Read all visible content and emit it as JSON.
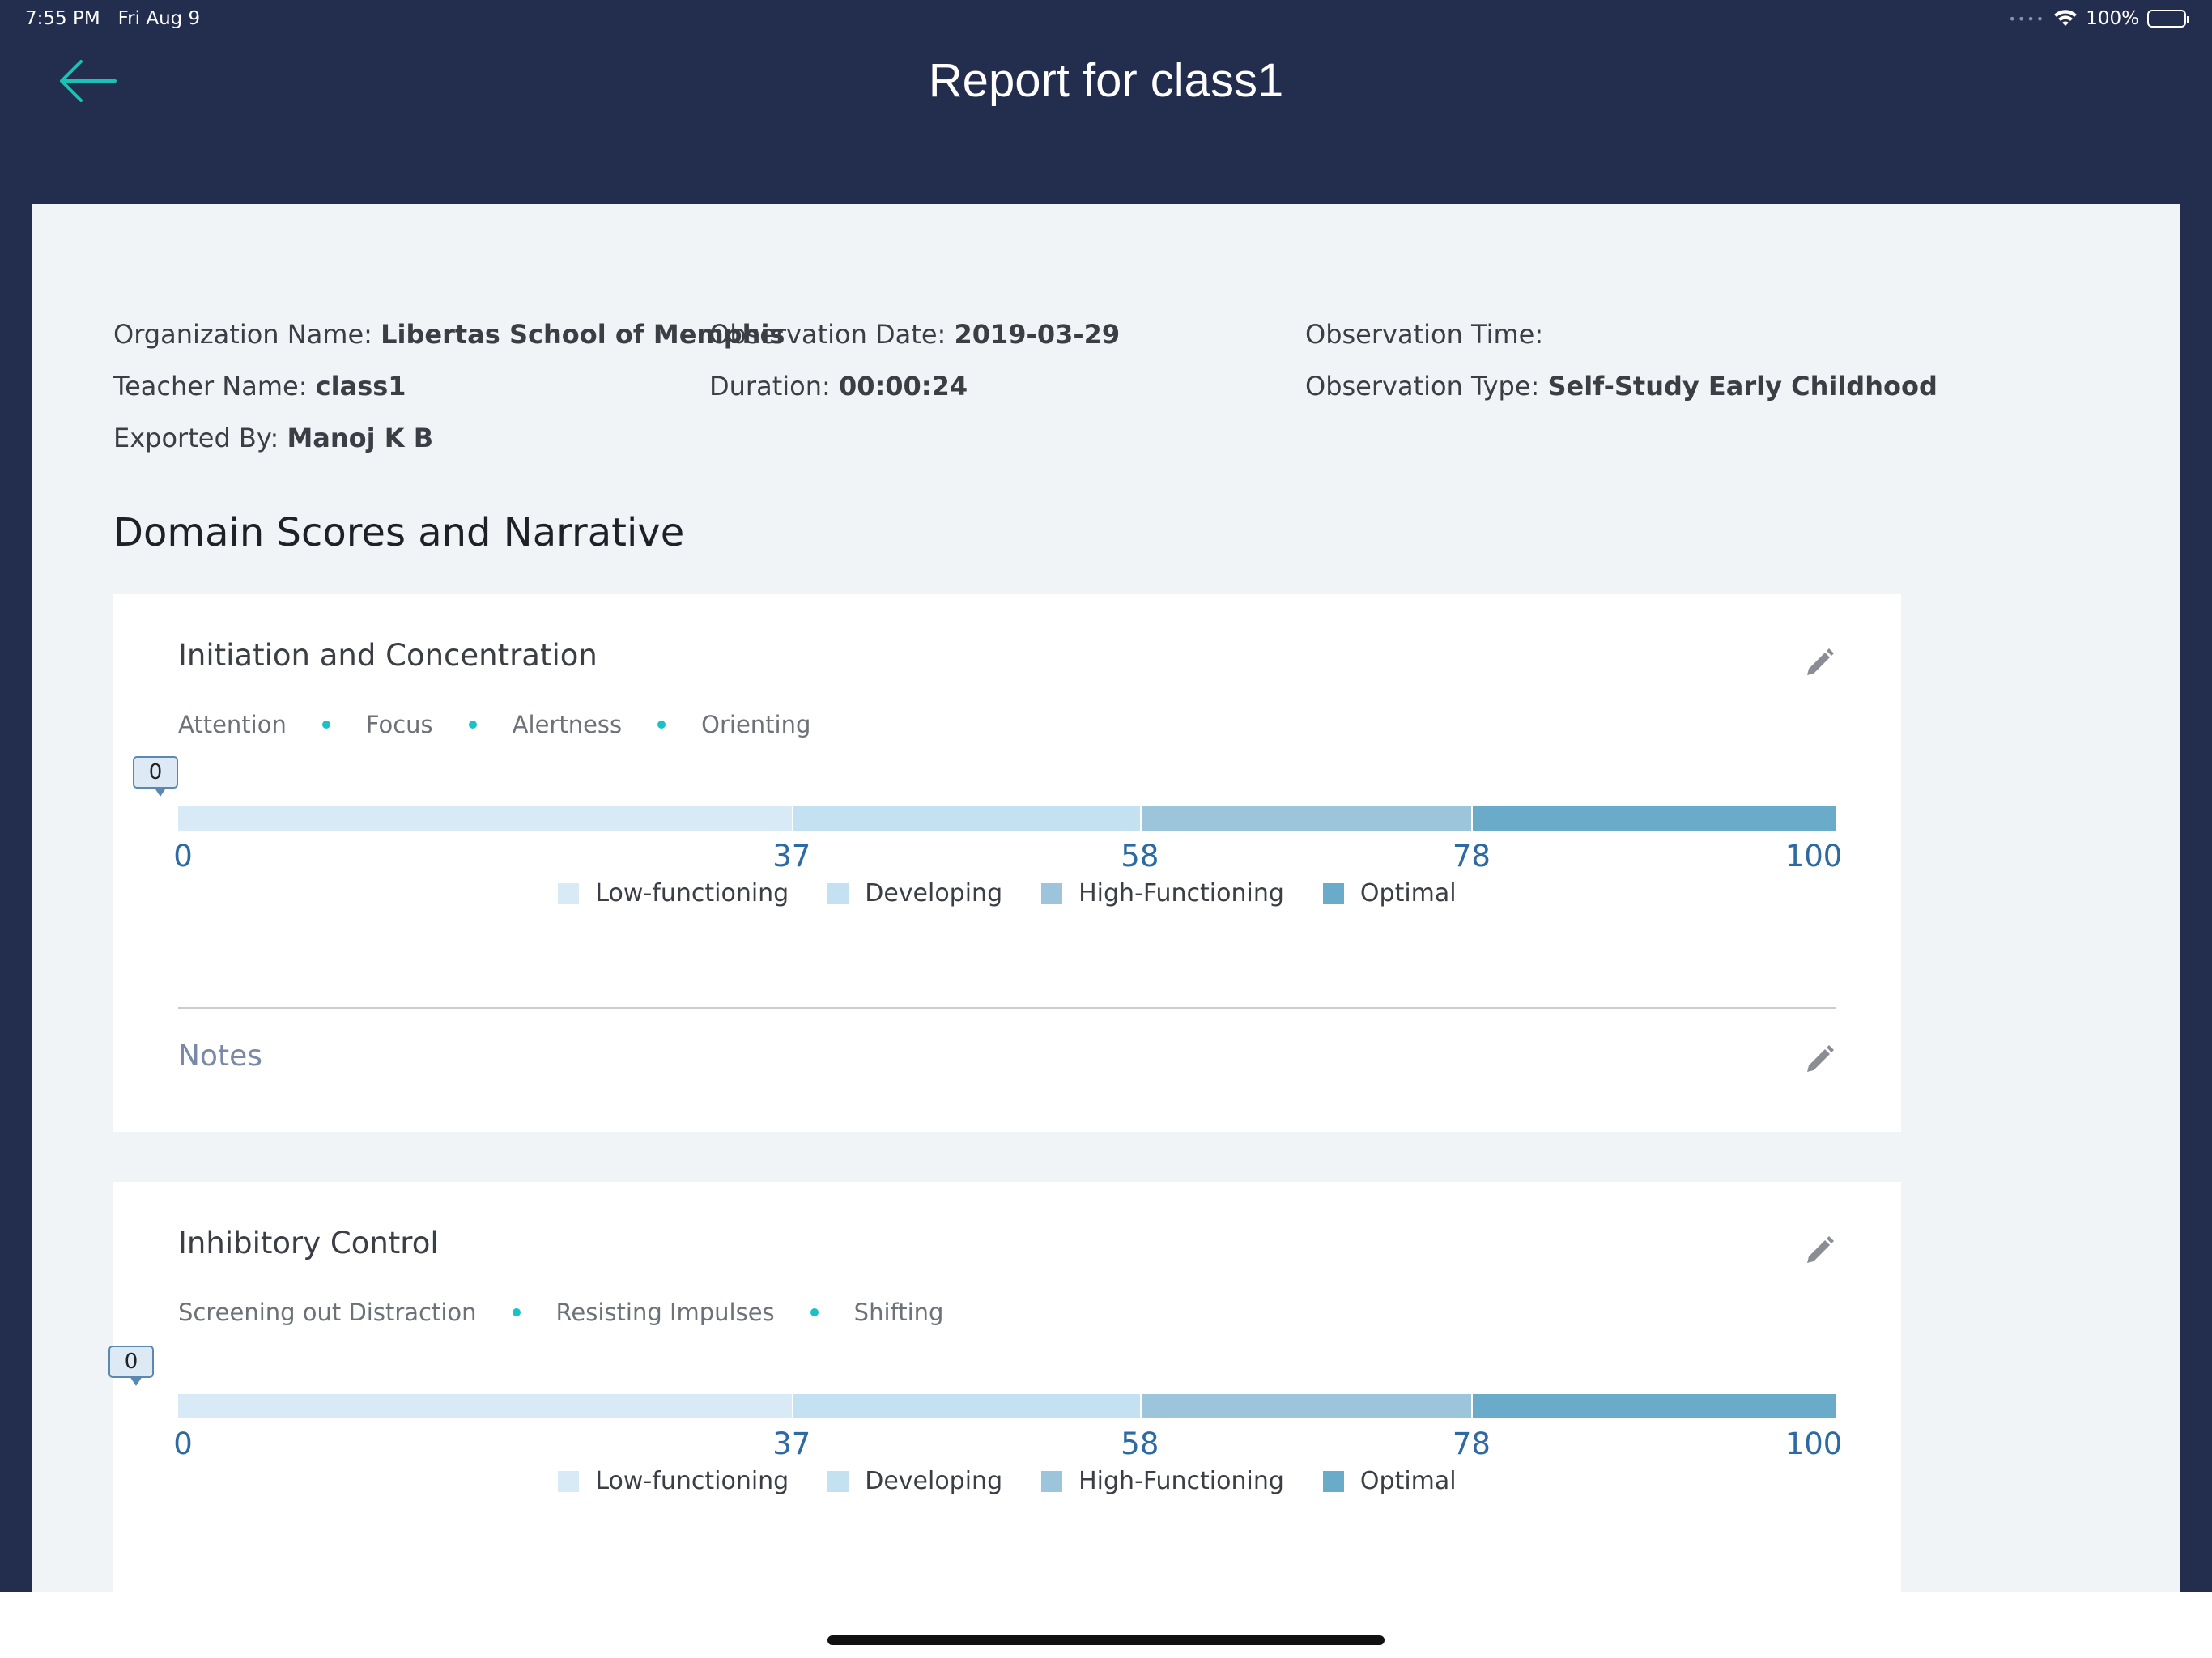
{
  "status": {
    "time": "7:55 PM",
    "date": "Fri Aug 9",
    "battery": "100%"
  },
  "header": {
    "title": "Report for class1"
  },
  "meta": {
    "org_label": "Organization Name: ",
    "org_value": "Libertas School of Memphis",
    "date_label": "Observation Date: ",
    "date_value": "2019-03-29",
    "time_label": "Observation Time:",
    "time_value": "",
    "teacher_label": "Teacher Name: ",
    "teacher_value": "class1",
    "duration_label": "Duration: ",
    "duration_value": "00:00:24",
    "type_label": "Observation Type: ",
    "type_value": "Self-Study Early Childhood",
    "exported_label": "Exported By: ",
    "exported_value": "Manoj K B"
  },
  "section_title": "Domain Scores and Narrative",
  "scale": {
    "ticks": [
      "0",
      "37",
      "58",
      "78",
      "100"
    ],
    "tick_values": [
      0,
      37,
      58,
      78,
      100
    ],
    "colors": [
      "#d8eaf5",
      "#c4e1f1",
      "#9cc5dc",
      "#6aabc9"
    ],
    "legend": [
      "Low-functioning",
      "Developing",
      "High-Functioning",
      "Optimal"
    ]
  },
  "cards": [
    {
      "title": "Initiation and Concentration",
      "subdomains": [
        "Attention",
        "Focus",
        "Alertness",
        "Orienting"
      ],
      "score": "0",
      "notes_label": "Notes"
    },
    {
      "title": "Inhibitory Control",
      "subdomains": [
        "Screening out Distraction",
        "Resisting Impulses",
        "Shifting"
      ],
      "score": "0"
    }
  ]
}
